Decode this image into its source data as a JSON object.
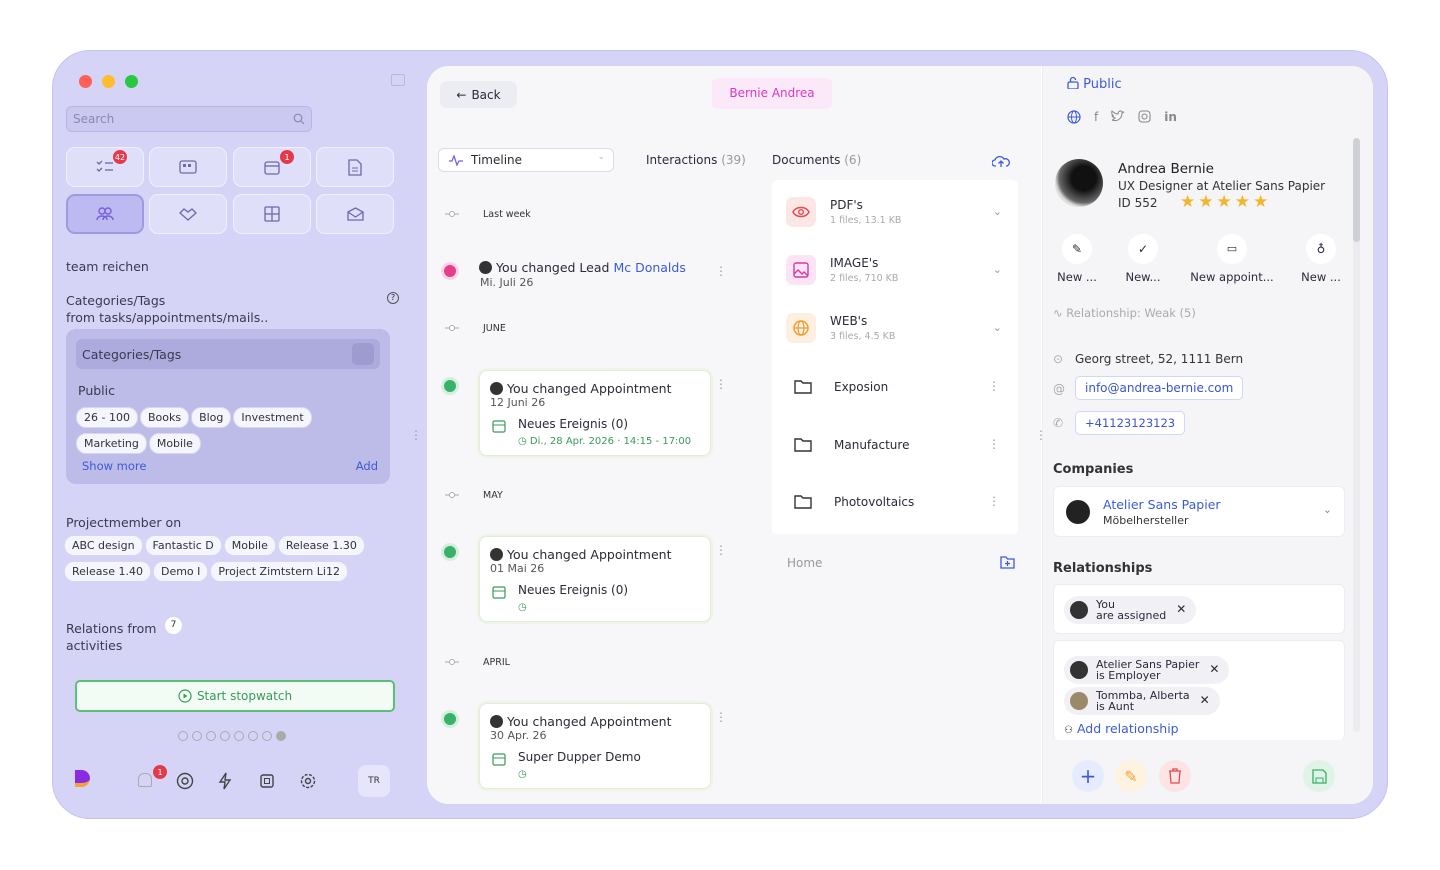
{
  "sidebar": {
    "search_placeholder": "Search",
    "badges": {
      "tasks": "42",
      "calendar": "1"
    },
    "team": "team reichen",
    "categories": {
      "title_line1": "Categories/Tags",
      "title_line2": "from tasks/appointments/mails..",
      "field_label": "Categories/Tags",
      "public_label": "Public",
      "tags": [
        "26 - 100",
        "Books",
        "Blog",
        "Investment",
        "Marketing",
        "Mobile"
      ],
      "show_more": "Show more",
      "add": "Add"
    },
    "projectmember": {
      "title": "Projectmember on",
      "chips": [
        "ABC design",
        "Fantastic D",
        "Mobile",
        "Release 1.30",
        "Release 1.40",
        "Demo I",
        "Project Zimtstern Li12"
      ]
    },
    "relations": {
      "line1": "Relations from",
      "line2": "activities",
      "count": "7"
    },
    "stopwatch": "Start stopwatch",
    "footer_badge": "1",
    "avatar_initials": "TR"
  },
  "header": {
    "back": "Back",
    "contact_name": "Bernie Andrea"
  },
  "timeline": {
    "select_label": "Timeline",
    "interactions_label": "Interactions",
    "interactions_count": "(39)",
    "sections": [
      "Last week",
      "JUNE",
      "MAY",
      "APRIL"
    ],
    "lead_event": {
      "text": "You changed Lead",
      "link": "Mc Donalds",
      "date": "Mi. Juli 26"
    },
    "cards": [
      {
        "title": "You changed Appointment",
        "date": "12 Juni 26",
        "event": "Neues Ereignis (0)",
        "time": "Di., 28 Apr. 2026  ·  14:15 - 17:00"
      },
      {
        "title": "You changed Appointment",
        "date": "01 Mai 26",
        "event": "Neues Ereignis (0)",
        "time": ""
      },
      {
        "title": "You changed Appointment",
        "date": "30 Apr. 26",
        "event": "Super Dupper Demo",
        "time": ""
      }
    ]
  },
  "documents": {
    "title": "Documents",
    "count": "(6)",
    "groups": [
      {
        "name": "PDF's",
        "sub": "1 files, 13.1 KB"
      },
      {
        "name": "IMAGE's",
        "sub": "2 files, 710 KB"
      },
      {
        "name": "WEB's",
        "sub": "3 files, 4.5 KB"
      }
    ],
    "folders": [
      "Exposion",
      "Manufacture",
      "Photovoltaics"
    ],
    "home": "Home"
  },
  "contact": {
    "visibility": "Public",
    "name": "Andrea Bernie",
    "role": "UX Designer at Atelier Sans Papier",
    "id": "ID 552",
    "rating": 5,
    "actions": [
      "New ...",
      "New...",
      "New appoint...",
      "New ..."
    ],
    "relationship": "Relationship: Weak (5)",
    "address": "Georg street, 52, 1111 Bern",
    "email": "info@andrea-bernie.com",
    "phone": "+41123123123",
    "companies_title": "Companies",
    "company": {
      "name": "Atelier Sans Papier",
      "type": "Möbelhersteller"
    },
    "relationships_title": "Relationships",
    "assigned": {
      "line1": "You",
      "line2": "are assigned"
    },
    "relations": [
      {
        "line1": "Atelier Sans Papier",
        "line2": "is Employer"
      },
      {
        "line1": "Tommba, Alberta",
        "line2": "is Aunt"
      }
    ],
    "add_relationship": "Add relationship"
  }
}
